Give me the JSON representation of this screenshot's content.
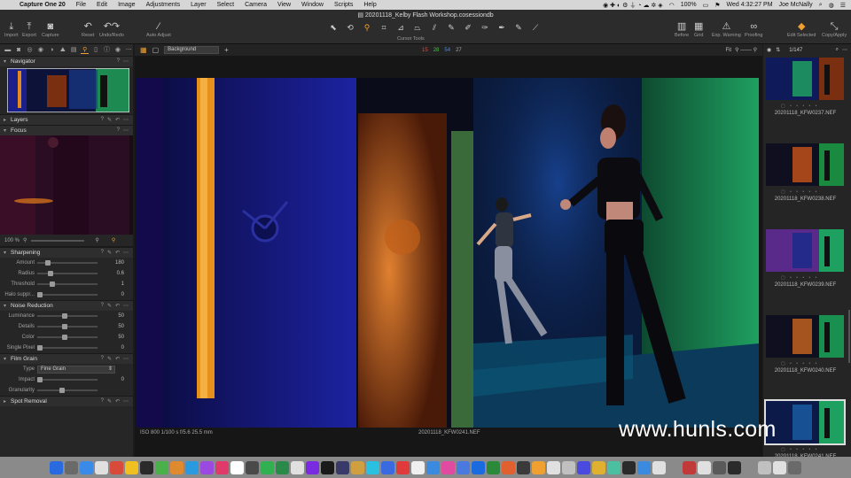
{
  "menubar": {
    "items": [
      "Capture One 20",
      "File",
      "Edit",
      "Image",
      "Adjustments",
      "Layer",
      "Select",
      "Camera",
      "View",
      "Window",
      "Scripts",
      "Help"
    ],
    "battery": "100%",
    "clock": "Wed 4:32:27 PM",
    "user": "Joe McNally"
  },
  "document_title": "20201118_Kelby Flash Workshop.cosessiondb",
  "toolbar": {
    "import": "Import",
    "export": "Export",
    "capture": "Capture",
    "reset": "Reset",
    "undo_redo": "Undo/Redo",
    "auto_adjust": "Auto Adjust",
    "cursor_tools": "Cursor Tools",
    "before": "Before",
    "grid": "Grid",
    "exp_warning": "Exp. Warning",
    "proofing": "Proofing",
    "edit_selected": "Edit Selected",
    "copy_apply": "Copy/Apply"
  },
  "viewbar": {
    "layer_select": "Background",
    "counts": [
      "15",
      "28",
      "54",
      "27"
    ],
    "fit": "Fit"
  },
  "left_panel": {
    "navigator": "Navigator",
    "layers": "Layers",
    "focus": "Focus",
    "focus_zoom": "100 %",
    "sharpening": {
      "title": "Sharpening",
      "rows": [
        {
          "label": "Amount",
          "value": "180",
          "pos": 0.14
        },
        {
          "label": "Radius",
          "value": "0.6",
          "pos": 0.2
        },
        {
          "label": "Threshold",
          "value": "1",
          "pos": 0.22
        },
        {
          "label": "Halo suppr...",
          "value": "0",
          "pos": 0.0
        }
      ]
    },
    "noise": {
      "title": "Noise Reduction",
      "rows": [
        {
          "label": "Luminance",
          "value": "50",
          "pos": 0.45
        },
        {
          "label": "Details",
          "value": "50",
          "pos": 0.45
        },
        {
          "label": "Color",
          "value": "50",
          "pos": 0.45
        },
        {
          "label": "Single Pixel",
          "value": "0",
          "pos": 0.0
        }
      ]
    },
    "film_grain": {
      "title": "Film Grain",
      "type_label": "Type",
      "type_value": "Fine Grain",
      "rows": [
        {
          "label": "Impact",
          "value": "0",
          "pos": 0.0
        },
        {
          "label": "Granularity",
          "value": "",
          "pos": 0.4
        }
      ]
    },
    "spot_removal": "Spot Removal"
  },
  "viewer": {
    "meta_left": "ISO 800    1/100 s    f/5.6    25.5 mm",
    "filename": "20201118_KFW0241.NEF"
  },
  "browser": {
    "count": "1/147",
    "thumbs": [
      {
        "name": "20201118_KFW0237.NEF"
      },
      {
        "name": "20201118_KFW0238.NEF"
      },
      {
        "name": "20201118_KFW0239.NEF"
      },
      {
        "name": "20201118_KFW0240.NEF"
      },
      {
        "name": "20201118_KFW0241.NEF"
      }
    ]
  },
  "watermark": "www.hunls.com",
  "colors": {
    "accent": "#f0a030"
  }
}
